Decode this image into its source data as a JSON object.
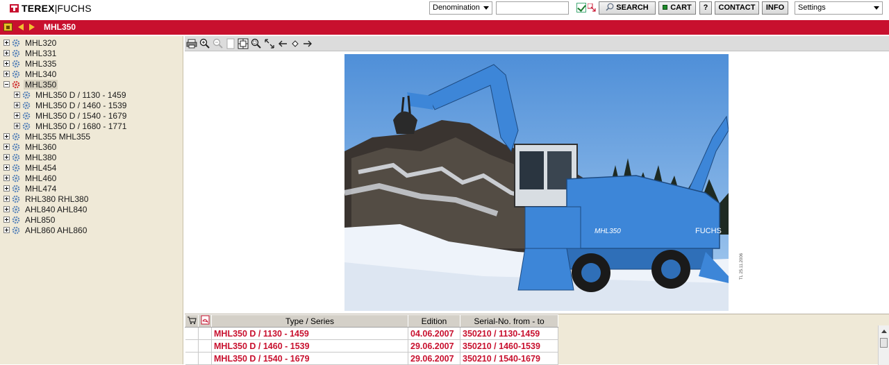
{
  "app": {
    "logo_brand": "TEREX",
    "logo_sub": "FUCHS"
  },
  "toolbar": {
    "search_field_select": "Denomination",
    "search_input_value": "",
    "search_label": "SEARCH",
    "cart_label": "CART",
    "help_label": "?",
    "contact_label": "CONTACT",
    "info_label": "INFO",
    "settings_select": "Settings"
  },
  "header": {
    "title": "MHL350"
  },
  "tree": {
    "items": [
      {
        "label": "MHL320",
        "level": 0,
        "expanded": false
      },
      {
        "label": "MHL331",
        "level": 0,
        "expanded": false
      },
      {
        "label": "MHL335",
        "level": 0,
        "expanded": false
      },
      {
        "label": "MHL340",
        "level": 0,
        "expanded": false
      },
      {
        "label": "MHL350",
        "level": 0,
        "expanded": true,
        "selected": true
      },
      {
        "label": "MHL350 D / 1130 - 1459",
        "level": 1,
        "expanded": false
      },
      {
        "label": "MHL350 D / 1460 - 1539",
        "level": 1,
        "expanded": false
      },
      {
        "label": "MHL350 D / 1540 - 1679",
        "level": 1,
        "expanded": false
      },
      {
        "label": "MHL350 D / 1680 - 1771",
        "level": 1,
        "expanded": false
      },
      {
        "label": "MHL355 MHL355",
        "level": 0,
        "expanded": false
      },
      {
        "label": "MHL360",
        "level": 0,
        "expanded": false
      },
      {
        "label": "MHL380",
        "level": 0,
        "expanded": false
      },
      {
        "label": "MHL454",
        "level": 0,
        "expanded": false
      },
      {
        "label": "MHL460",
        "level": 0,
        "expanded": false
      },
      {
        "label": "MHL474",
        "level": 0,
        "expanded": false
      },
      {
        "label": "RHL380 RHL380",
        "level": 0,
        "expanded": false
      },
      {
        "label": "AHL840 AHL840",
        "level": 0,
        "expanded": false
      },
      {
        "label": "AHL850",
        "level": 0,
        "expanded": false
      },
      {
        "label": "AHL860 AHL860",
        "level": 0,
        "expanded": false
      }
    ]
  },
  "image_tools": [
    "print-icon",
    "zoom-in-icon",
    "zoom-out-icon",
    "fit-page-icon",
    "fit-width-icon",
    "zoom-area-icon",
    "full-size-icon",
    "arrow-left-icon",
    "diamond-icon",
    "arrow-right-icon"
  ],
  "photo": {
    "machine_text": "MHL350",
    "brand_text": "FUCHS",
    "stamp": "TL 25.11.2006"
  },
  "table": {
    "headers": {
      "type": "Type / Series",
      "edition": "Edition",
      "serial": "Serial-No. from - to"
    },
    "rows": [
      {
        "type": "MHL350 D / 1130 - 1459",
        "edition": "04.06.2007",
        "serial": "350210 / 1130-1459"
      },
      {
        "type": "MHL350 D / 1460 - 1539",
        "edition": "29.06.2007",
        "serial": "350210 / 1460-1539"
      },
      {
        "type": "MHL350 D / 1540 - 1679",
        "edition": "29.06.2007",
        "serial": "350210 / 1540-1679"
      }
    ]
  },
  "colors": {
    "brand_red": "#c8102e",
    "tree_bg": "#efe9d7",
    "link_red": "#c8102e"
  }
}
